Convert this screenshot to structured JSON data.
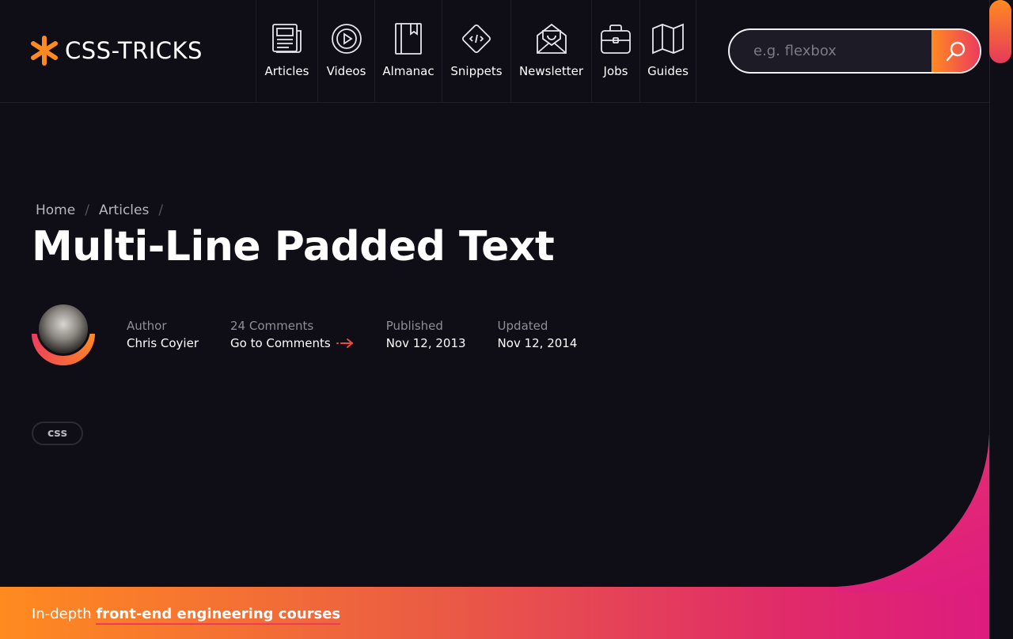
{
  "header": {
    "logo_text": "CSS-TRICKS",
    "nav": [
      {
        "label": "Articles",
        "icon": "newspaper-icon"
      },
      {
        "label": "Videos",
        "icon": "play-circle-icon"
      },
      {
        "label": "Almanac",
        "icon": "book-icon"
      },
      {
        "label": "Snippets",
        "icon": "code-diamond-icon"
      },
      {
        "label": "Newsletter",
        "icon": "envelope-icon"
      },
      {
        "label": "Jobs",
        "icon": "briefcase-icon"
      },
      {
        "label": "Guides",
        "icon": "map-icon"
      }
    ],
    "search": {
      "placeholder": "e.g. flexbox",
      "icon": "search-icon"
    }
  },
  "article": {
    "breadcrumb": [
      "Home",
      "Articles"
    ],
    "title": "Multi-Line Padded Text",
    "meta": {
      "author_label": "Author",
      "author_name": "Chris Coyier",
      "comments_label": "24 Comments",
      "comments_link": "Go to Comments",
      "published_label": "Published",
      "published_date": "Nov 12, 2013",
      "updated_label": "Updated",
      "updated_date": "Nov 12, 2014"
    },
    "tag": "css"
  },
  "promo": {
    "prefix": "In-depth ",
    "link": "front-end engineering courses"
  },
  "colors": {
    "accent_orange": "#ff8a20",
    "accent_pink": "#de1c7f",
    "background": "#0f0d15"
  }
}
